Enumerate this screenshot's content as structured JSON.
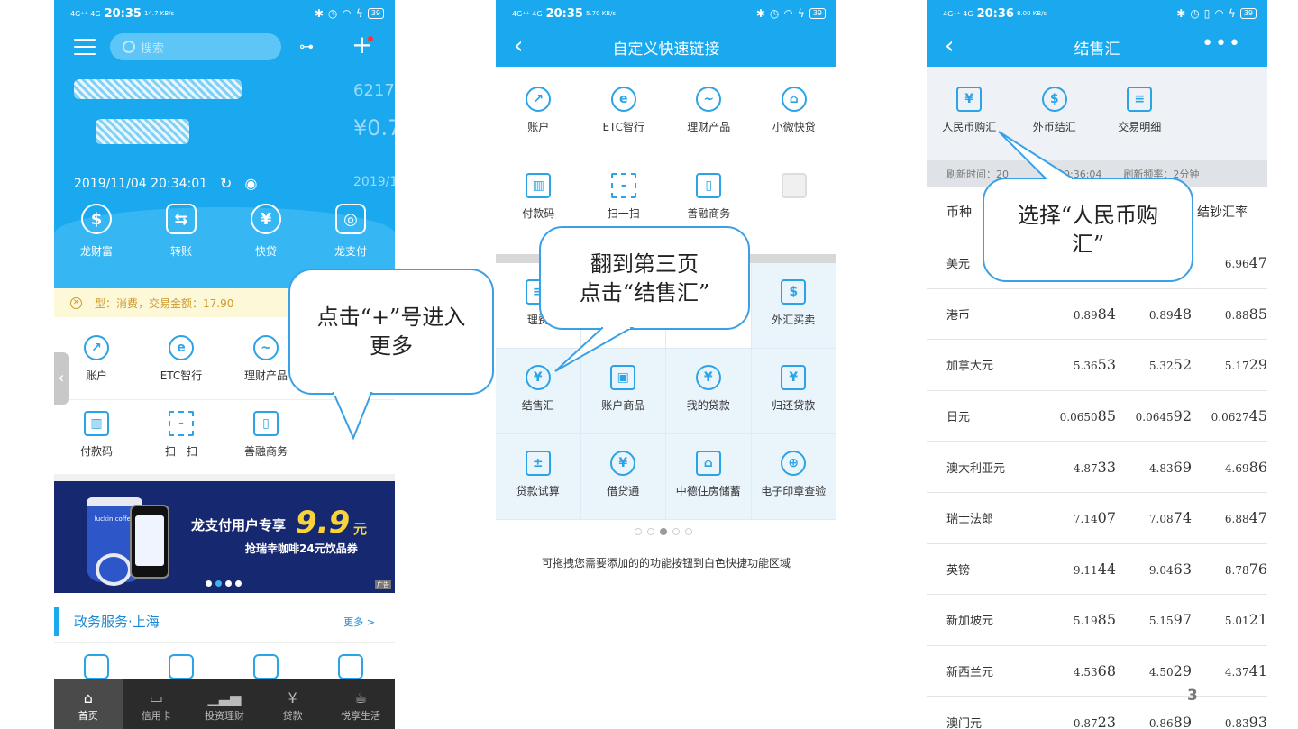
{
  "phone1": {
    "status": {
      "signal": "4G⁺⁺ 4G",
      "time": "20:35",
      "speed": "14.7 KB/s",
      "battery": "39"
    },
    "search_placeholder": "搜索",
    "account_masked": "6217",
    "balance_masked": "¥0.7",
    "timestamp": "2019/11/04 20:34:01",
    "timestamp_right": "2019/1",
    "quick_actions": [
      "龙财富",
      "转账",
      "快贷",
      "龙支付"
    ],
    "notice": "型：消费，交易金额：17.90",
    "grid_row1": [
      "账户",
      "ETC智行",
      "理财产品"
    ],
    "grid_row2": [
      "付款码",
      "扫一扫",
      "善融商务"
    ],
    "banner": {
      "title": "龙支付用户专享",
      "price": "9.9",
      "unit": "元",
      "subtitle": "抢瑞幸咖啡24元饮品券",
      "cup_label": "luckin coffee",
      "ad_tag": "广告"
    },
    "gov": {
      "title": "政务服务·上海",
      "more": "更多 >"
    },
    "tabs": [
      "首页",
      "信用卡",
      "投资理财",
      "贷款",
      "悦享生活"
    ]
  },
  "phone2": {
    "status": {
      "signal": "4G⁺⁺ 4G",
      "time": "20:35",
      "speed": "5.70 KB/s",
      "battery": "39"
    },
    "title": "自定义快速链接",
    "row1": [
      "账户",
      "ETC智行",
      "理财产品",
      "小微快贷"
    ],
    "row2": [
      "付款码",
      "扫一扫",
      "善融商务",
      ""
    ],
    "row3": [
      "理费",
      "",
      "",
      "外汇买卖"
    ],
    "row4": [
      "结售汇",
      "账户商品",
      "我的贷款",
      "归还贷款"
    ],
    "row5": [
      "贷款试算",
      "借贷通",
      "中德住房储蓄",
      "电子印章查验"
    ],
    "hint": "可拖拽您需要添加的的功能按钮到白色快捷功能区域"
  },
  "phone3": {
    "status": {
      "signal": "4G⁺⁺ 4G",
      "time": "20:36",
      "speed": "8.00 KB/s",
      "battery": "39"
    },
    "title": "结售汇",
    "menu": [
      "人民币购汇",
      "外币结汇",
      "交易明细"
    ],
    "refresh_time": "刷新时间：20",
    "refresh_time_tail": "20:36:04",
    "refresh_rate": "刷新频率：2分钟",
    "header_currency": "币种",
    "header_rate": "结钞汇率",
    "rows": [
      {
        "name": "美元",
        "c1": "",
        "c1b": "",
        "c2": "",
        "c2b": "",
        "c3": "6.96",
        "c3b": "47"
      },
      {
        "name": "港币",
        "c1": "0.89",
        "c1b": "84",
        "c2": "0.89",
        "c2b": "48",
        "c3": "0.88",
        "c3b": "85"
      },
      {
        "name": "加拿大元",
        "c1": "5.36",
        "c1b": "53",
        "c2": "5.32",
        "c2b": "52",
        "c3": "5.17",
        "c3b": "29"
      },
      {
        "name": "日元",
        "c1": "0.0650",
        "c1b": "85",
        "c2": "0.0645",
        "c2b": "92",
        "c3": "0.0627",
        "c3b": "45"
      },
      {
        "name": "澳大利亚元",
        "c1": "4.87",
        "c1b": "33",
        "c2": "4.83",
        "c2b": "69",
        "c3": "4.69",
        "c3b": "86"
      },
      {
        "name": "瑞士法郎",
        "c1": "7.14",
        "c1b": "07",
        "c2": "7.08",
        "c2b": "74",
        "c3": "6.88",
        "c3b": "47"
      },
      {
        "name": "英镑",
        "c1": "9.11",
        "c1b": "44",
        "c2": "9.04",
        "c2b": "63",
        "c3": "8.78",
        "c3b": "76"
      },
      {
        "name": "新加坡元",
        "c1": "5.19",
        "c1b": "85",
        "c2": "5.15",
        "c2b": "97",
        "c3": "5.01",
        "c3b": "21"
      },
      {
        "name": "新西兰元",
        "c1": "4.53",
        "c1b": "68",
        "c2": "4.50",
        "c2b": "29",
        "c3": "4.37",
        "c3b": "41"
      },
      {
        "name": "澳门元",
        "c1": "0.87",
        "c1b": "23",
        "c2": "0.86",
        "c2b": "89",
        "c3": "0.83",
        "c3b": "93"
      }
    ]
  },
  "callouts": {
    "c1": "点击“+”号进入更多",
    "c2_line1": "翻到第三页",
    "c2_line2": "点击“结售汇”",
    "c3": "选择“人民币购汇”"
  },
  "page_number": "3",
  "colors": {
    "brand_blue": "#1aa9ee",
    "callout_border": "#3aa0e6",
    "tabbar": "#2b2b2b"
  }
}
